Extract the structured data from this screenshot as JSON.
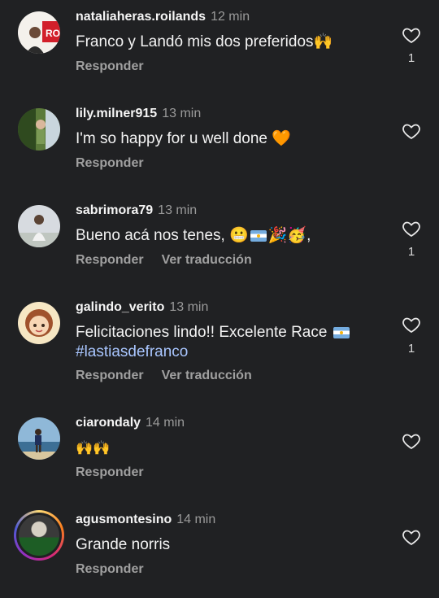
{
  "reply_label": "Responder",
  "translate_label": "Ver traducción",
  "comments": [
    {
      "username": "nataliaheras.roilands",
      "time": "12 min",
      "text": "Franco y Landó mis dos preferidos🙌",
      "likes": "1"
    },
    {
      "username": "lily.milner915",
      "time": "13 min",
      "text": "I'm so happy for u well done 🧡",
      "likes": ""
    },
    {
      "username": "sabrimora79",
      "time": "13 min",
      "text": "Bueno acá nos tenes, 😬",
      "text_after_flag": "🎉🥳,",
      "likes": "1"
    },
    {
      "username": "galindo_verito",
      "time": "13 min",
      "text": "Felicitaciones lindo!! Excelente Race",
      "hashtag": "#lastiasdefranco",
      "likes": "1"
    },
    {
      "username": "ciarondaly",
      "time": "14 min",
      "text": "🙌🙌",
      "likes": ""
    },
    {
      "username": "agusmontesino",
      "time": "14 min",
      "text": "Grande norris",
      "likes": ""
    }
  ],
  "icons": {
    "heart": "heart-outline-icon"
  }
}
